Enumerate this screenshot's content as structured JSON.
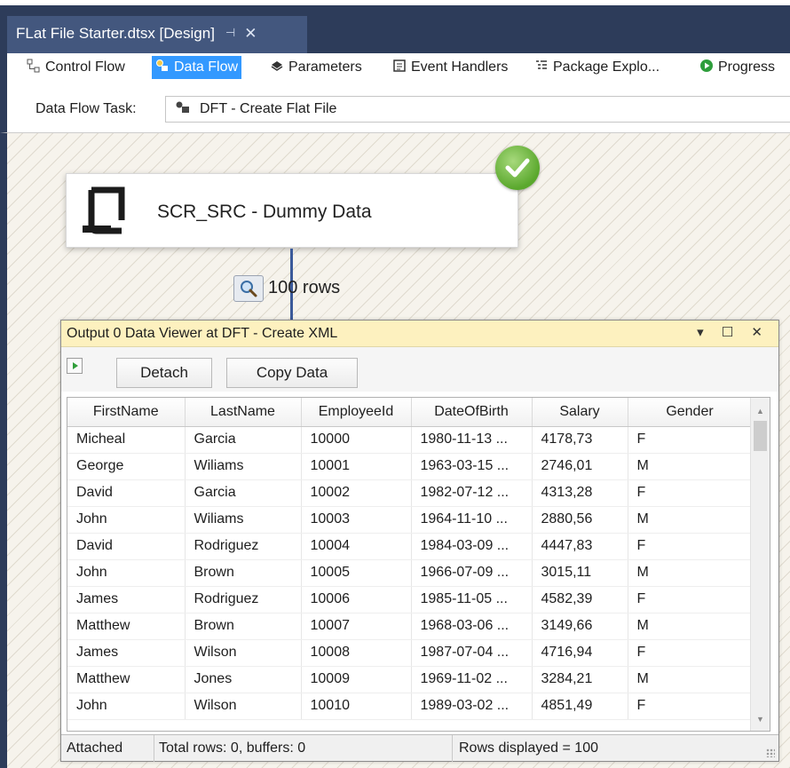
{
  "document_tab": {
    "title": "FLat File Starter.dtsx [Design]",
    "pin": "⊣",
    "close": "✕"
  },
  "designer_tabs": [
    {
      "label": "Control Flow",
      "icon": "control-flow-icon"
    },
    {
      "label": "Data Flow",
      "icon": "data-flow-icon",
      "active": true
    },
    {
      "label": "Parameters",
      "icon": "parameters-icon"
    },
    {
      "label": "Event Handlers",
      "icon": "event-handlers-icon"
    },
    {
      "label": "Package Explo...",
      "icon": "package-explorer-icon"
    },
    {
      "label": "Progress",
      "icon": "progress-icon"
    }
  ],
  "task": {
    "label": "Data Flow Task:",
    "value": "DFT - Create Flat File"
  },
  "component": {
    "name": "SCR_SRC - Dummy Data",
    "status": "success"
  },
  "path": {
    "rows_label": "100 rows"
  },
  "data_viewer": {
    "title": "Output 0 Data Viewer at DFT - Create XML",
    "window_controls": "▾ ☐ ✕",
    "detach_label": "Detach",
    "copy_label": "Copy Data",
    "columns": [
      "FirstName",
      "LastName",
      "EmployeeId",
      "DateOfBirth",
      "Salary",
      "Gender"
    ],
    "rows": [
      [
        "Micheal",
        "Garcia",
        "10000",
        "1980-11-13 ...",
        "4178,73",
        "F"
      ],
      [
        "George",
        "Wiliams",
        "10001",
        "1963-03-15 ...",
        "2746,01",
        "M"
      ],
      [
        "David",
        "Garcia",
        "10002",
        "1982-07-12 ...",
        "4313,28",
        "F"
      ],
      [
        "John",
        "Wiliams",
        "10003",
        "1964-11-10 ...",
        "2880,56",
        "M"
      ],
      [
        "David",
        "Rodriguez",
        "10004",
        "1984-03-09 ...",
        "4447,83",
        "F"
      ],
      [
        "John",
        "Brown",
        "10005",
        "1966-07-09 ...",
        "3015,11",
        "M"
      ],
      [
        "James",
        "Rodriguez",
        "10006",
        "1985-11-05 ...",
        "4582,39",
        "F"
      ],
      [
        "Matthew",
        "Brown",
        "10007",
        "1968-03-06 ...",
        "3149,66",
        "M"
      ],
      [
        "James",
        "Wilson",
        "10008",
        "1987-07-04 ...",
        "4716,94",
        "F"
      ],
      [
        "Matthew",
        "Jones",
        "10009",
        "1969-11-02 ...",
        "3284,21",
        "M"
      ],
      [
        "John",
        "Wilson",
        "10010",
        "1989-03-02 ...",
        "4851,49",
        "F"
      ]
    ],
    "status": {
      "state": "Attached",
      "totals": "Total rows: 0, buffers: 0",
      "displayed": "Rows displayed = 100"
    }
  },
  "colors": {
    "tab_strip": "#2d3c5a",
    "active_tab": "#3399ff",
    "viewer_title": "#fdf1bf",
    "success": "#5aa82d"
  }
}
